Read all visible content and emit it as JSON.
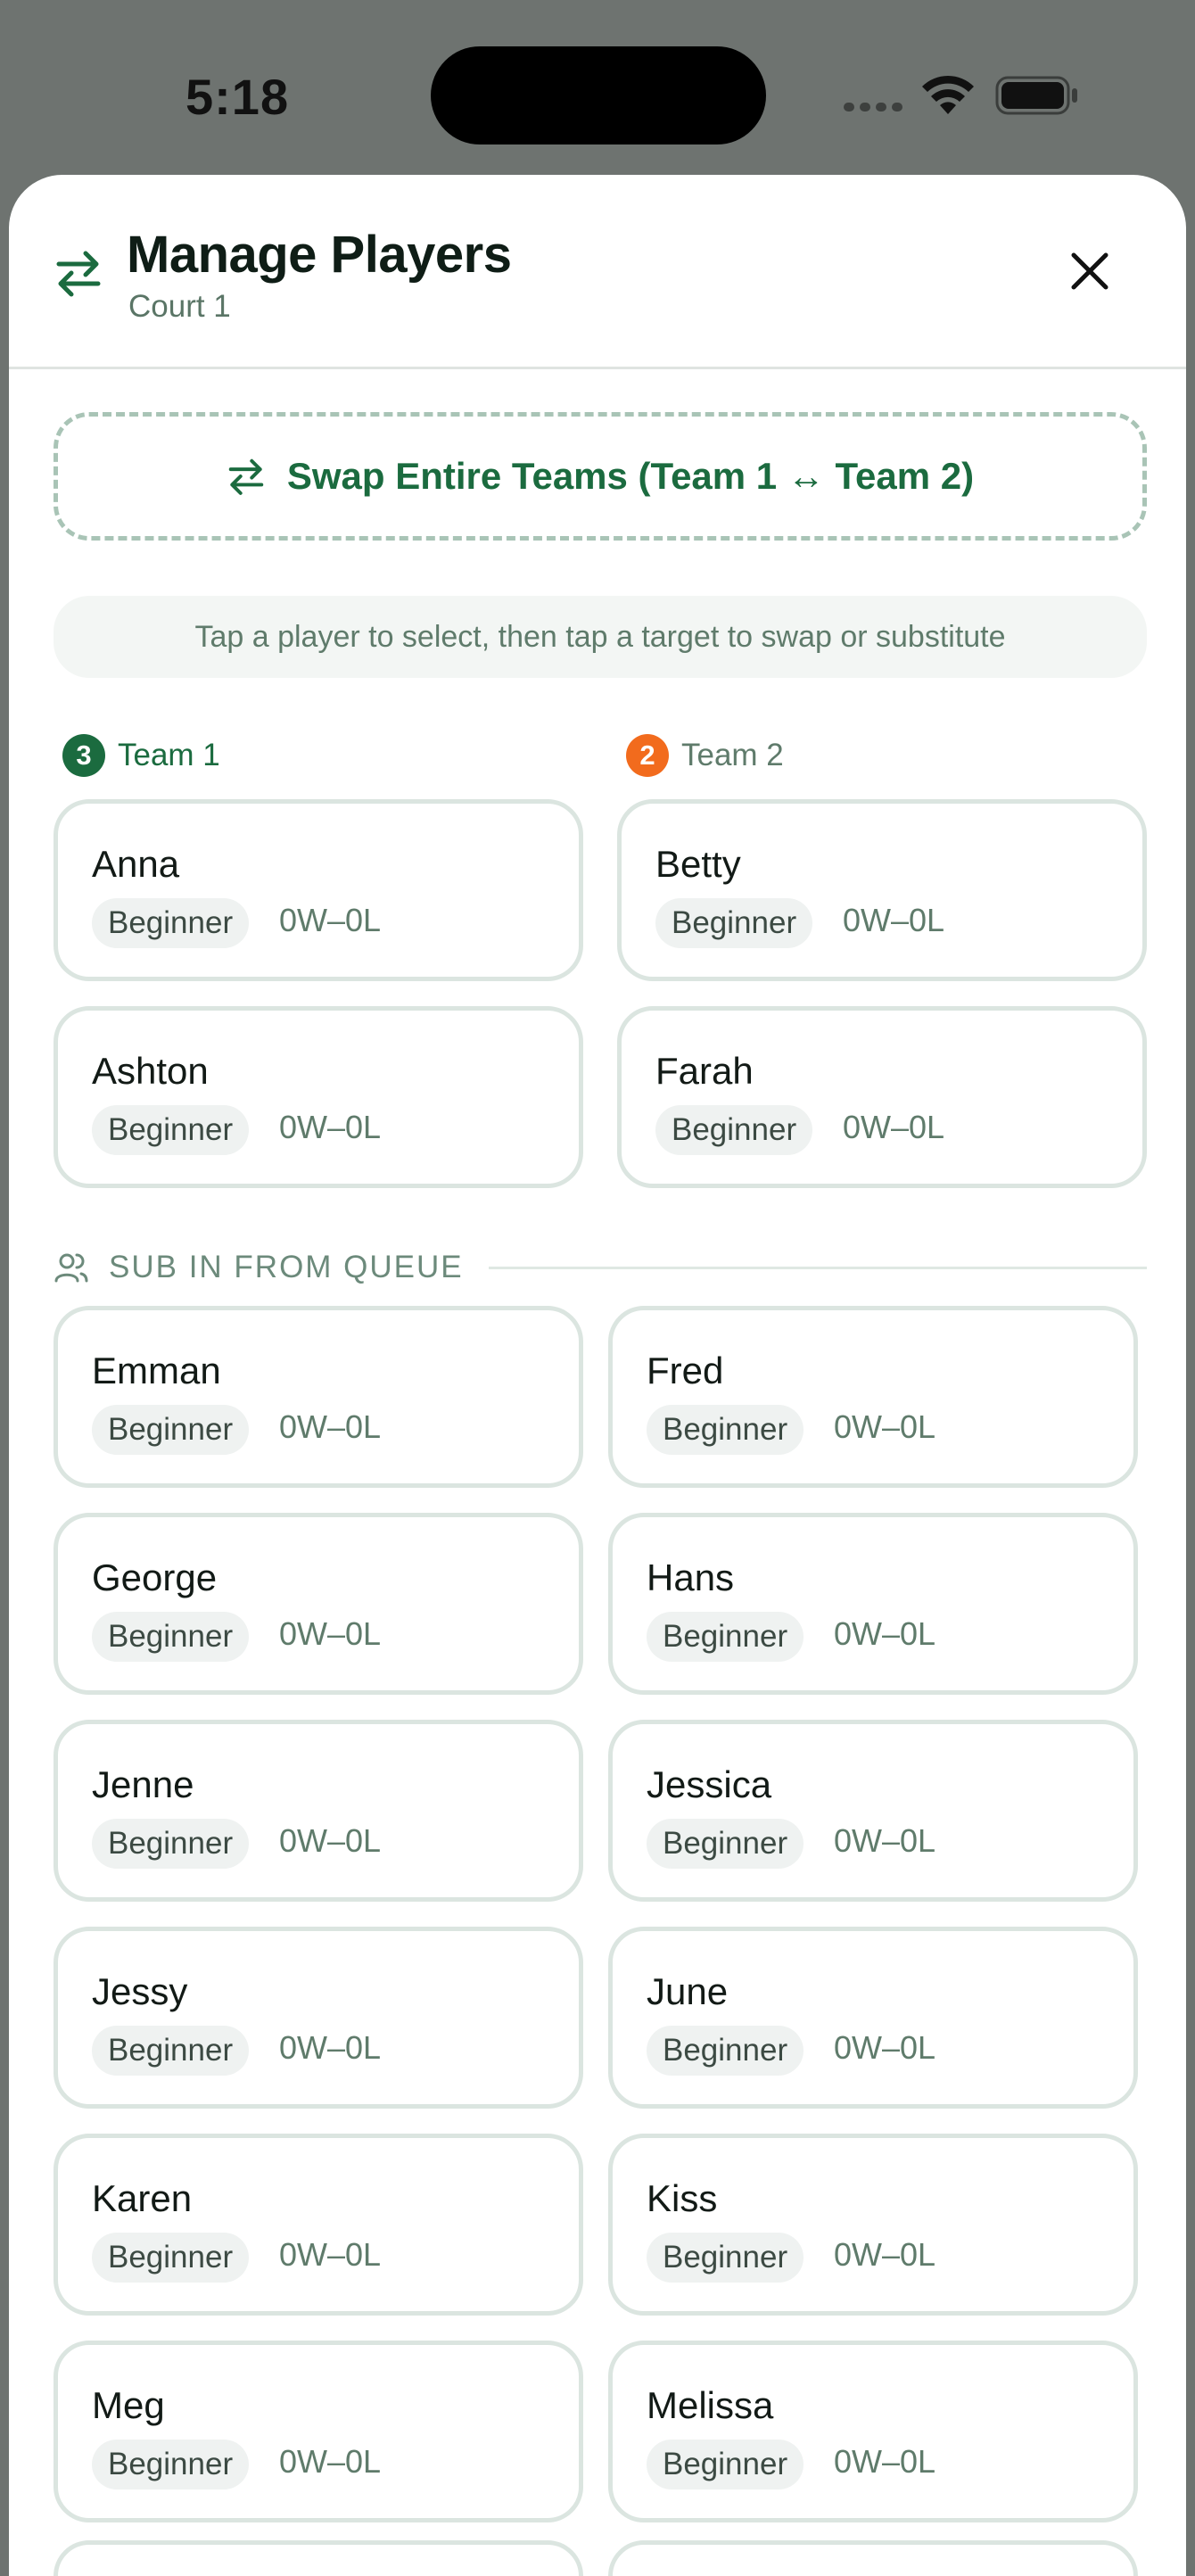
{
  "status_bar": {
    "time": "5:18"
  },
  "header": {
    "title": "Manage Players",
    "subtitle": "Court 1"
  },
  "swap_all_label": "Swap Entire Teams (Team 1 ↔ Team 2)",
  "hint": "Tap a player to select, then tap a target to swap or substitute",
  "teams": [
    {
      "label": "Team 1",
      "count": "3",
      "color": "#1b6b3f",
      "players": [
        {
          "name": "Anna",
          "level": "Beginner",
          "record": "0W–0L"
        },
        {
          "name": "Ashton",
          "level": "Beginner",
          "record": "0W–0L"
        }
      ]
    },
    {
      "label": "Team 2",
      "count": "2",
      "color": "#f26b1d",
      "players": [
        {
          "name": "Betty",
          "level": "Beginner",
          "record": "0W–0L"
        },
        {
          "name": "Farah",
          "level": "Beginner",
          "record": "0W–0L"
        }
      ]
    }
  ],
  "queue": {
    "label": "SUB IN FROM QUEUE",
    "players": [
      {
        "name": "Emman",
        "level": "Beginner",
        "record": "0W–0L"
      },
      {
        "name": "Fred",
        "level": "Beginner",
        "record": "0W–0L"
      },
      {
        "name": "George",
        "level": "Beginner",
        "record": "0W–0L"
      },
      {
        "name": "Hans",
        "level": "Beginner",
        "record": "0W–0L"
      },
      {
        "name": "Jenne",
        "level": "Beginner",
        "record": "0W–0L"
      },
      {
        "name": "Jessica",
        "level": "Beginner",
        "record": "0W–0L"
      },
      {
        "name": "Jessy",
        "level": "Beginner",
        "record": "0W–0L"
      },
      {
        "name": "June",
        "level": "Beginner",
        "record": "0W–0L"
      },
      {
        "name": "Karen",
        "level": "Beginner",
        "record": "0W–0L"
      },
      {
        "name": "Kiss",
        "level": "Beginner",
        "record": "0W–0L"
      },
      {
        "name": "Meg",
        "level": "Beginner",
        "record": "0W–0L"
      },
      {
        "name": "Melissa",
        "level": "Beginner",
        "record": "0W–0L"
      }
    ]
  },
  "icons": {
    "header": "swap-arrows-icon",
    "close": "close-icon",
    "swap_all": "swap-arrows-icon",
    "queue": "users-icon"
  }
}
